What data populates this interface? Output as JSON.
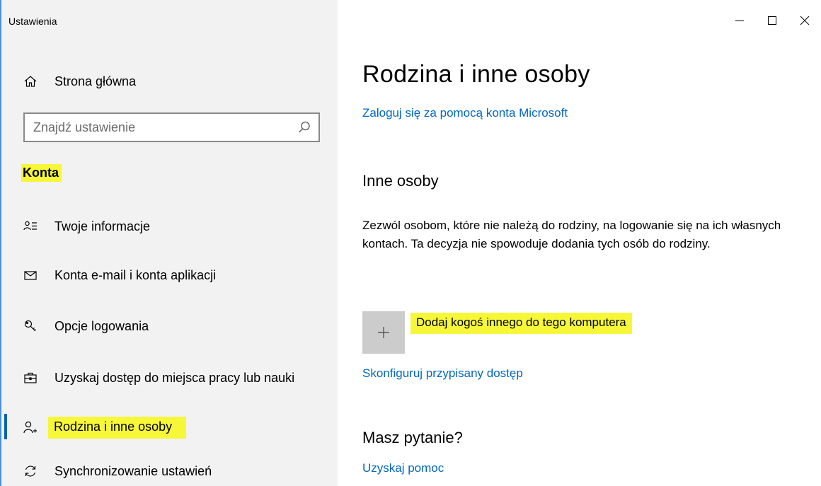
{
  "window": {
    "app_title": "Ustawienia"
  },
  "sidebar": {
    "home_label": "Strona główna",
    "search": {
      "placeholder": "Znajdź ustawienie",
      "value": ""
    },
    "section_label": "Konta",
    "items": [
      {
        "label": "Twoje informacje",
        "icon": "person-info-icon"
      },
      {
        "label": "Konta e-mail i konta aplikacji",
        "icon": "mail-icon"
      },
      {
        "label": "Opcje logowania",
        "icon": "key-icon"
      },
      {
        "label": "Uzyskaj dostęp do miejsca pracy lub nauki",
        "icon": "briefcase-icon"
      },
      {
        "label": "Rodzina i inne osoby",
        "icon": "person-add-icon",
        "active": true
      },
      {
        "label": "Synchronizowanie ustawień",
        "icon": "sync-icon"
      }
    ]
  },
  "main": {
    "title": "Rodzina i inne osoby",
    "signin_link": "Zaloguj się za pomocą konta Microsoft",
    "other_people": {
      "heading": "Inne osoby",
      "description": "Zezwól osobom, które nie należą do rodziny, na logowanie się na ich własnych kontach. Ta decyzja nie spowoduje dodania tych osób do rodziny.",
      "add_label": "Dodaj kogoś innego do tego komputera",
      "assigned_access_link": "Skonfiguruj przypisany dostęp"
    },
    "question": {
      "heading": "Masz pytanie?",
      "help_link": "Uzyskaj pomoc"
    }
  },
  "colors": {
    "accent": "#0067c0",
    "highlight": "#f7f73a",
    "sidebar_bg": "#f2f2f2",
    "tile_bg": "#cccccc"
  }
}
